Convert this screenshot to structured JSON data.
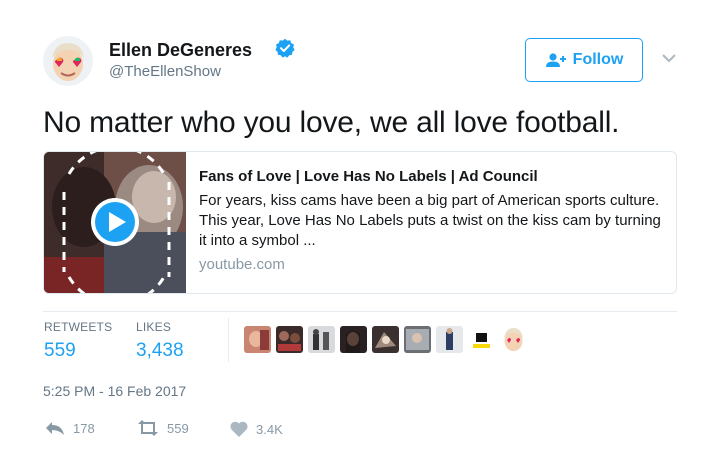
{
  "author": {
    "name": "Ellen DeGeneres",
    "handle": "@TheEllenShow",
    "verified": true
  },
  "follow_button": {
    "label": "Follow",
    "icon": "add-user-icon"
  },
  "tweet": {
    "text": "No matter who you love, we all love football."
  },
  "card": {
    "title": "Fans of Love | Love Has No Labels | Ad Council",
    "description": "For years, kiss cams have been a big part of American sports culture. This year, Love Has No Labels puts a twist on the kiss cam by turning it into a symbol ...",
    "domain": "youtube.com",
    "play_icon": "play-icon"
  },
  "stats": {
    "retweets_label": "RETWEETS",
    "retweets_value": "559",
    "likes_label": "LIKES",
    "likes_value": "3,438"
  },
  "timestamp": "5:25 PM - 16 Feb 2017",
  "actions": {
    "reply_count": "178",
    "retweet_count": "559",
    "like_count": "3.4K"
  },
  "colors": {
    "accent": "#1da1f2",
    "text": "#14171a",
    "muted": "#657786",
    "border": "#e1e8ed"
  }
}
